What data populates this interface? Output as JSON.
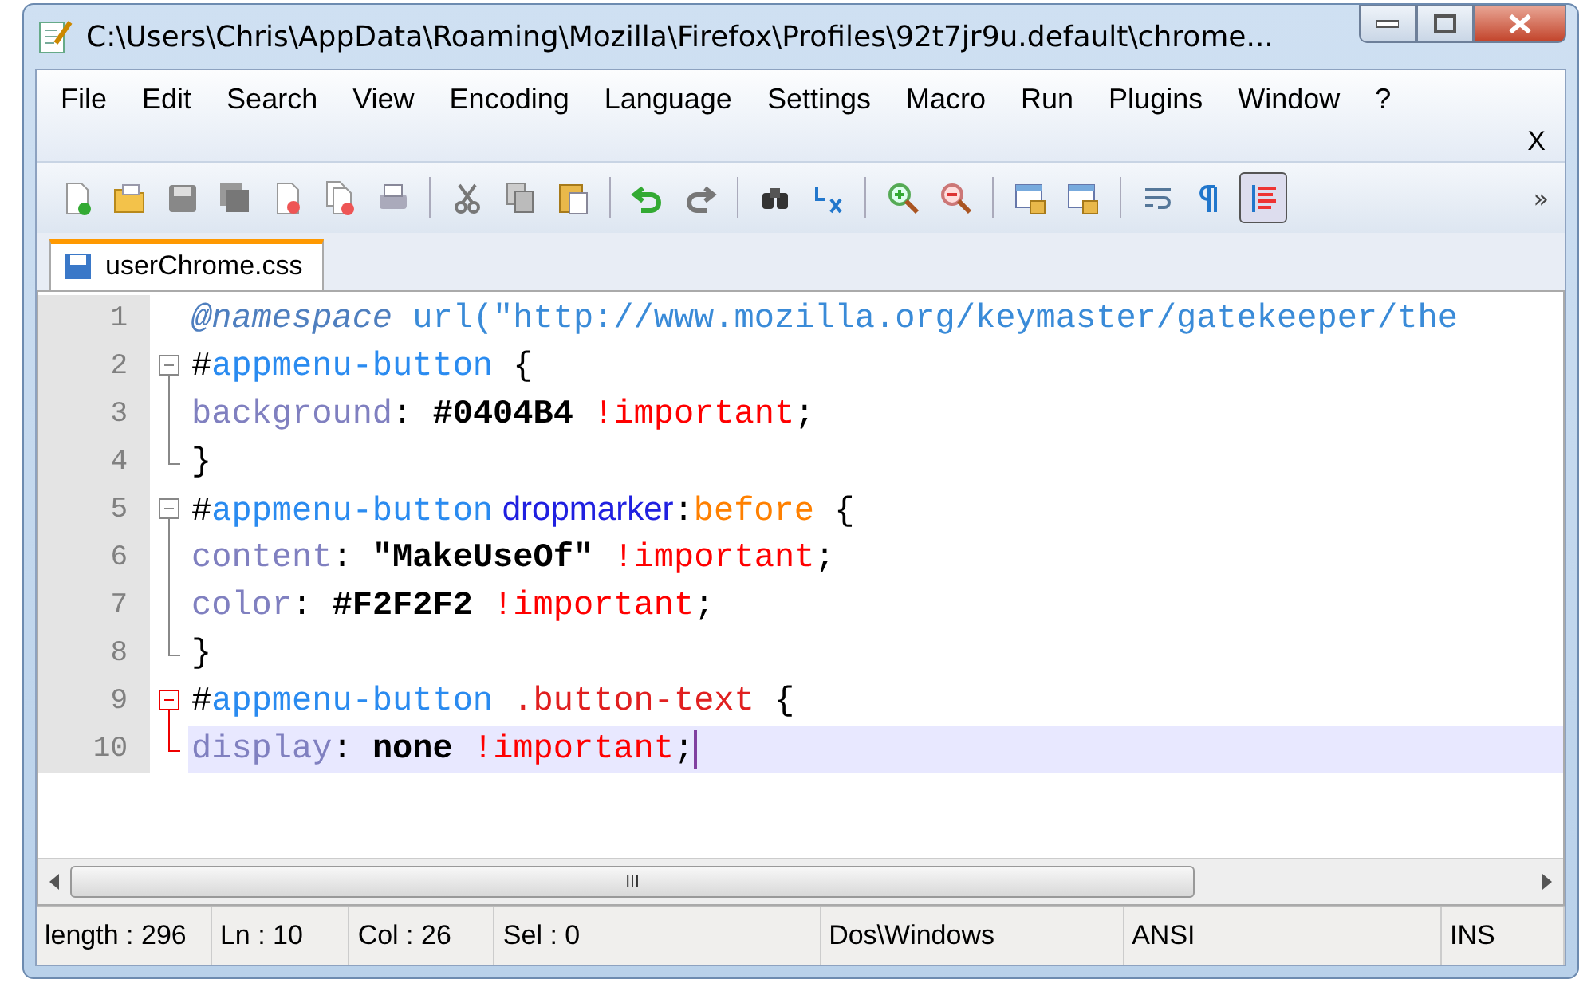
{
  "window": {
    "title": "C:\\Users\\Chris\\AppData\\Roaming\\Mozilla\\Firefox\\Profiles\\92t7jr9u.default\\chrome..."
  },
  "menu": [
    "File",
    "Edit",
    "Search",
    "View",
    "Encoding",
    "Language",
    "Settings",
    "Macro",
    "Run",
    "Plugins",
    "Window",
    "?"
  ],
  "close_document": "X",
  "toolbar": [
    {
      "kind": "new",
      "pressed": false
    },
    {
      "kind": "open",
      "pressed": false
    },
    {
      "kind": "save",
      "pressed": false
    },
    {
      "kind": "saveall",
      "pressed": false
    },
    {
      "kind": "close",
      "pressed": false
    },
    {
      "kind": "closeall",
      "pressed": false
    },
    {
      "kind": "print",
      "pressed": false
    },
    {
      "kind": "sep"
    },
    {
      "kind": "cut",
      "pressed": false
    },
    {
      "kind": "copy",
      "pressed": false
    },
    {
      "kind": "paste",
      "pressed": false
    },
    {
      "kind": "sep"
    },
    {
      "kind": "undo",
      "pressed": false
    },
    {
      "kind": "redo",
      "pressed": false
    },
    {
      "kind": "sep"
    },
    {
      "kind": "find",
      "pressed": false
    },
    {
      "kind": "replace",
      "pressed": false
    },
    {
      "kind": "sep"
    },
    {
      "kind": "zoomin",
      "pressed": false
    },
    {
      "kind": "zoomout",
      "pressed": false
    },
    {
      "kind": "sep"
    },
    {
      "kind": "lock",
      "pressed": false
    },
    {
      "kind": "lock2",
      "pressed": false
    },
    {
      "kind": "sep"
    },
    {
      "kind": "wrap",
      "pressed": false
    },
    {
      "kind": "para",
      "pressed": false
    },
    {
      "kind": "guide",
      "pressed": true
    }
  ],
  "toolbar_overflow": "»",
  "tabs": [
    {
      "label": "userChrome.css",
      "selected": true
    }
  ],
  "editor": {
    "lines": [
      {
        "number": "1",
        "current": false,
        "tokens": [
          {
            "atrule": "@namespace"
          },
          {
            "url": " url(\"http://www.mozilla.org/keymaster/gatekeeper/the"
          }
        ]
      },
      {
        "number": "2",
        "current": false,
        "expanded": true,
        "highlighted": false,
        "tokens": [
          {
            "plain": "#"
          },
          {
            "id": "appmenu-button"
          },
          {
            "plain": " {"
          }
        ],
        "children": [
          {
            "number": "3",
            "current": false,
            "tokens": [
              {
                "prop": "background"
              },
              {
                "plain": ": "
              },
              {
                "value": "#0404B4"
              },
              {
                "imp": " !important"
              },
              {
                "plain": ";"
              }
            ]
          },
          {
            "number": "4",
            "current": false,
            "tokens": [
              {
                "plain": "}"
              }
            ]
          }
        ]
      },
      {
        "number": "5",
        "current": false,
        "expanded": true,
        "highlighted": false,
        "tokens": [
          {
            "plain": "#"
          },
          {
            "id": "appmenu-button"
          },
          {
            "elem": " dropmarker"
          },
          {
            "plain": ":"
          },
          {
            "pseudo": "before"
          },
          {
            "plain": " {"
          }
        ],
        "children": [
          {
            "number": "6",
            "current": false,
            "tokens": [
              {
                "prop": "content"
              },
              {
                "plain": ": "
              },
              {
                "value": "\"MakeUseOf\""
              },
              {
                "imp": " !important"
              },
              {
                "plain": ";"
              }
            ]
          },
          {
            "number": "7",
            "current": false,
            "tokens": [
              {
                "prop": "color"
              },
              {
                "plain": ": "
              },
              {
                "value": "#F2F2F2"
              },
              {
                "imp": " !important"
              },
              {
                "plain": ";"
              }
            ]
          },
          {
            "number": "8",
            "current": false,
            "tokens": [
              {
                "plain": "}"
              }
            ]
          }
        ]
      },
      {
        "number": "9",
        "current": false,
        "expanded": true,
        "highlighted": true,
        "tokens": [
          {
            "plain": "#"
          },
          {
            "id": "appmenu-button"
          },
          {
            "class": " .button-text"
          },
          {
            "plain": " {"
          }
        ],
        "children": [
          {
            "number": "10",
            "current": true,
            "tokens": [
              {
                "prop": "display"
              },
              {
                "plain": ": "
              },
              {
                "value": "none"
              },
              {
                "imp": " !important"
              },
              {
                "plain": ";"
              }
            ]
          }
        ]
      }
    ]
  },
  "scrollbar_grip": "III",
  "status_bar": [
    "length : 296",
    "Ln : 10",
    "Col : 26",
    "Sel : 0",
    "Dos\\Windows",
    "ANSI",
    "INS"
  ]
}
